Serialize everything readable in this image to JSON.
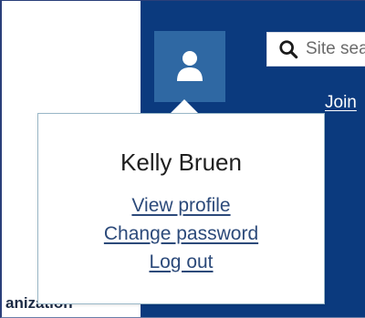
{
  "header": {
    "search": {
      "placeholder": "Site search",
      "icon": "search-icon"
    },
    "join_label": "Join",
    "avatar_icon": "user-icon",
    "brand_color": "#0b3a7e",
    "avatar_bg_color": "#2f68a3"
  },
  "background_text": "anization",
  "user_menu": {
    "user_name": "Kelly Bruen",
    "links": [
      {
        "label": "View profile"
      },
      {
        "label": "Change password"
      },
      {
        "label": "Log out"
      }
    ],
    "link_color": "#2c4a7a"
  }
}
